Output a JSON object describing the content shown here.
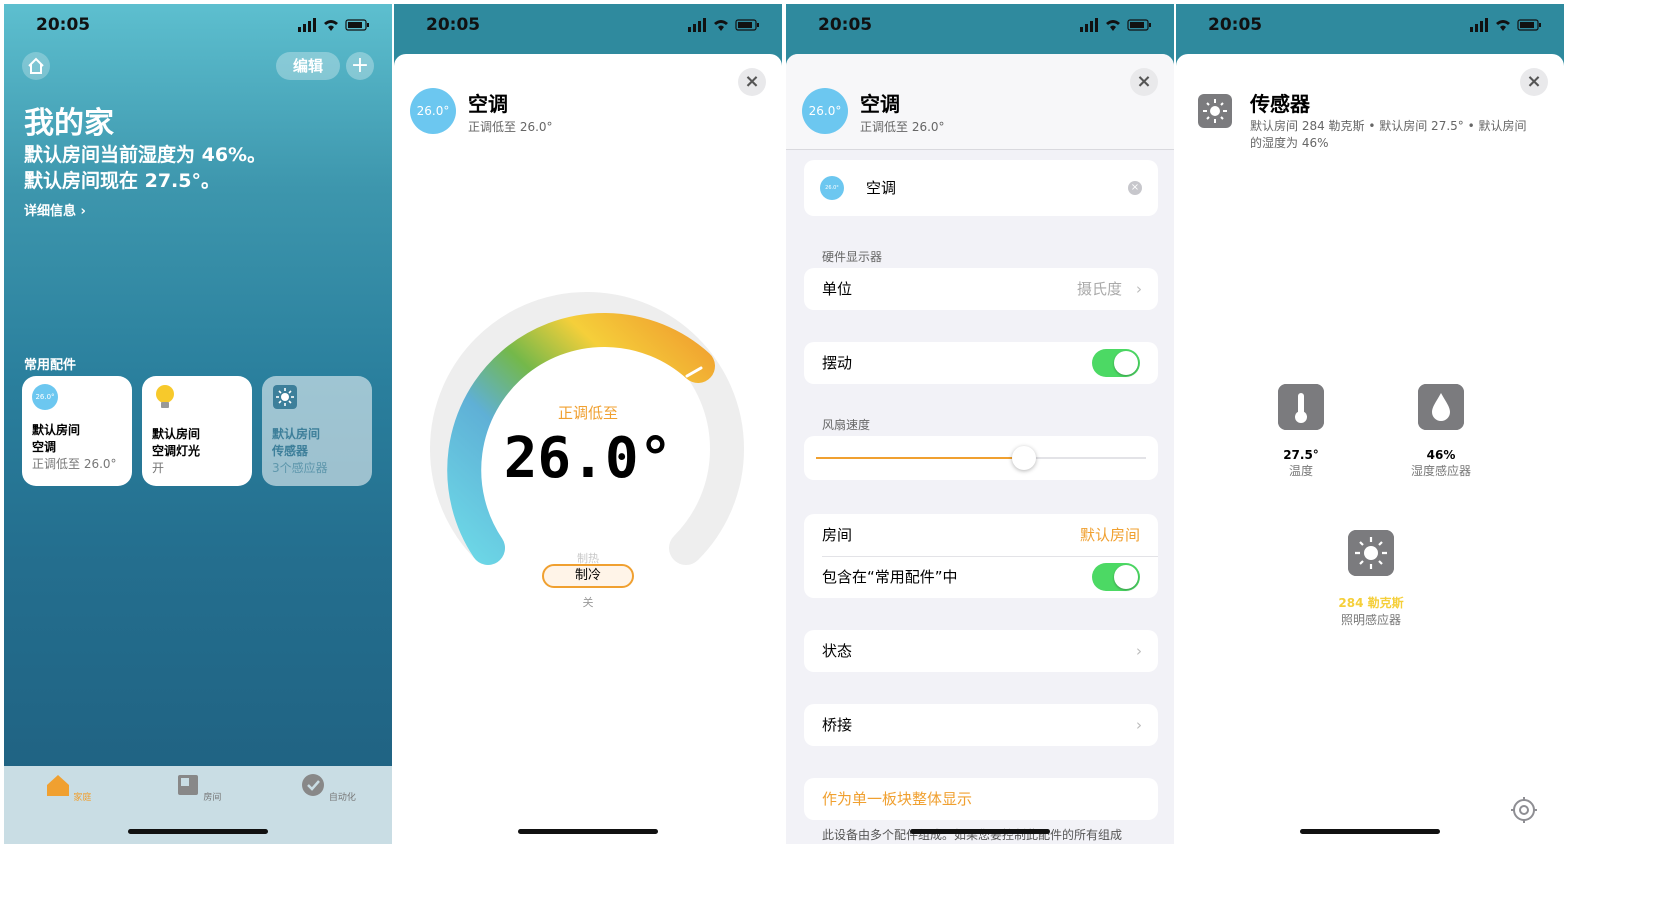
{
  "status_time": "20:05",
  "home": {
    "edit_label": "编辑",
    "add_label": "+",
    "title": "我的家",
    "status_line1": "默认房间当前湿度为 46%。",
    "status_line2": "默认房间现在 27.5°。",
    "detail_link": "详细信息 ›",
    "favorites_label": "常用配件",
    "tiles": [
      {
        "badge": "26.0°",
        "room": "默认房间",
        "name": "空调",
        "state": "正调低至 26.0°"
      },
      {
        "room": "默认房间",
        "name": "空调灯光",
        "state": "开"
      },
      {
        "room": "默认房间",
        "name": "传感器",
        "state": "3个感应器"
      }
    ],
    "tabs": [
      {
        "label": "家庭",
        "icon": "house-icon"
      },
      {
        "label": "房间",
        "icon": "rooms-icon"
      },
      {
        "label": "自动化",
        "icon": "automation-icon"
      }
    ]
  },
  "ac": {
    "badge": "26.0°",
    "name": "空调",
    "subtitle": "正调低至 26.0°",
    "close": "×",
    "dial_label": "正调低至",
    "dial_value": "26.0°",
    "mode_heat": "制热",
    "mode_cool": "制冷",
    "mode_off": "关",
    "colors": {
      "accent": "#f0a030",
      "cool": "#6cc7f0",
      "green": "#74b84a"
    }
  },
  "ac_settings": {
    "accessory_name": "空调",
    "badge": "26.0°",
    "hw_display_label": "硬件显示器",
    "unit_label": "单位",
    "unit_value": "摄氏度",
    "swing_label": "摆动",
    "swing_on": true,
    "fan_speed_label": "风扇速度",
    "fan_speed_fraction": 0.63,
    "room_label": "房间",
    "room_value": "默认房间",
    "include_fav_label": "包含在“常用配件”中",
    "include_fav_on": true,
    "status_label": "状态",
    "bridge_label": "桥接",
    "show_as_single_tile": "作为单一板块整体显示",
    "footnote": "此设备由多个配件组成。如果您要控制此配件的所有组成"
  },
  "sensor": {
    "title": "传感器",
    "subtitle": "默认房间 284 勒克斯 • 默认房间 27.5° • 默认房间的湿度为 46%",
    "tiles": [
      {
        "value": "27.5°",
        "name": "温度",
        "icon": "thermometer-icon"
      },
      {
        "value": "46%",
        "name": "湿度感应器",
        "icon": "drop-icon"
      },
      {
        "value": "284 勒克斯",
        "name": "照明感应器",
        "icon": "sun-icon"
      }
    ]
  }
}
